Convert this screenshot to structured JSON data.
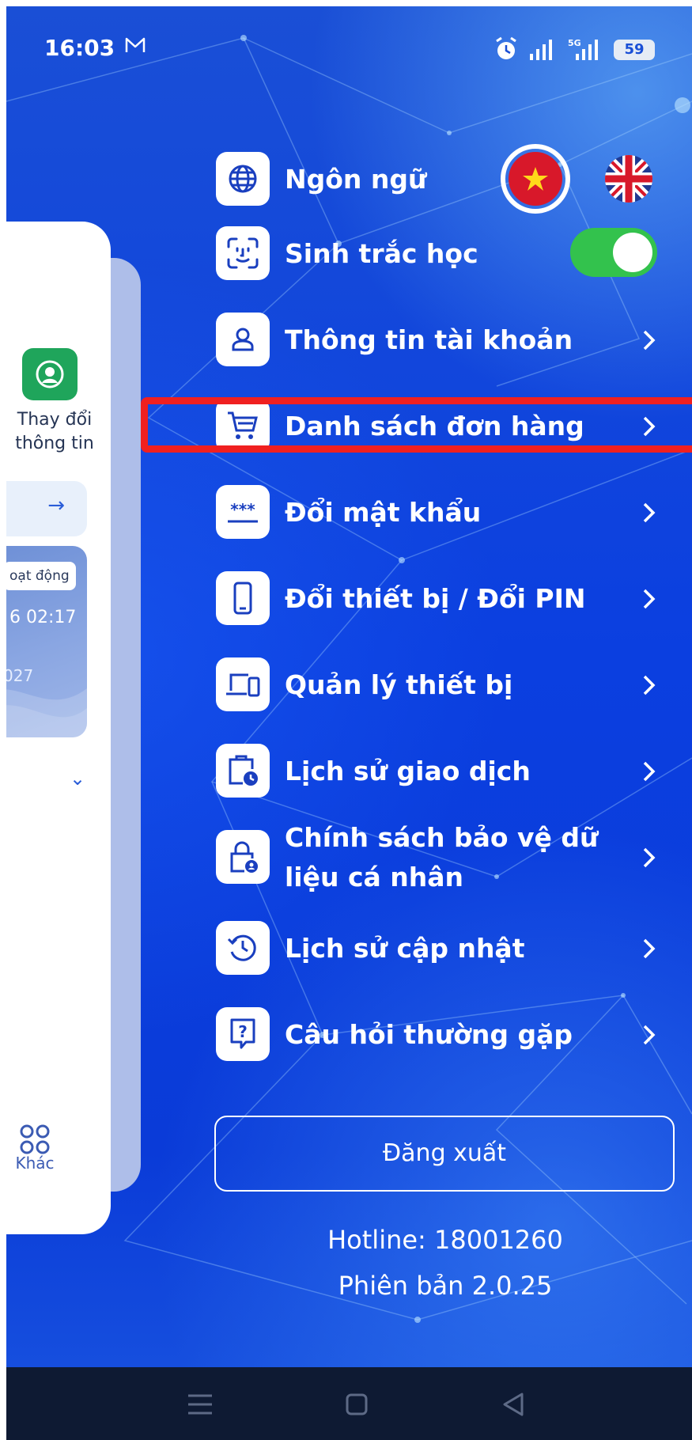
{
  "status_bar": {
    "time": "16:03",
    "network_label": "5G",
    "battery": "59",
    "icons": [
      "mail-icon",
      "alarm-icon",
      "signal-icon",
      "signal-5g-icon",
      "battery-icon"
    ]
  },
  "side_panel": {
    "change_info_label": "Thay đổi thông tin",
    "activity_badge": "oạt động",
    "time_value": "6 02:17",
    "year_value": "027",
    "other_label": "Khác"
  },
  "settings": {
    "language_label": "Ngôn ngữ",
    "biometrics_label": "Sinh trắc học",
    "biometrics_enabled": true,
    "items": [
      {
        "label": "Thông tin tài khoản",
        "icon": "user-icon"
      },
      {
        "label": "Danh sách đơn hàng",
        "icon": "cart-icon"
      },
      {
        "label": "Đổi mật khẩu",
        "icon": "password-icon"
      },
      {
        "label": "Đổi thiết bị / Đổi PIN",
        "icon": "phone-icon"
      },
      {
        "label": "Quản lý thiết bị",
        "icon": "devices-icon"
      },
      {
        "label": "Lịch sử giao dịch",
        "icon": "transaction-history-icon"
      },
      {
        "label": "Chính sách bảo vệ dữ liệu cá nhân",
        "icon": "privacy-lock-icon"
      },
      {
        "label": "Lịch sử cập nhật",
        "icon": "update-history-icon"
      },
      {
        "label": "Câu hỏi thường gặp",
        "icon": "faq-icon"
      }
    ],
    "logout_label": "Đăng xuất",
    "hotline": "Hotline: 18001260",
    "version": "Phiên bản 2.0.25"
  },
  "colors": {
    "background": "#0b3fe0",
    "highlight": "#f02020",
    "toggle_on": "#33c24d",
    "accent_green": "#1fa55b"
  }
}
